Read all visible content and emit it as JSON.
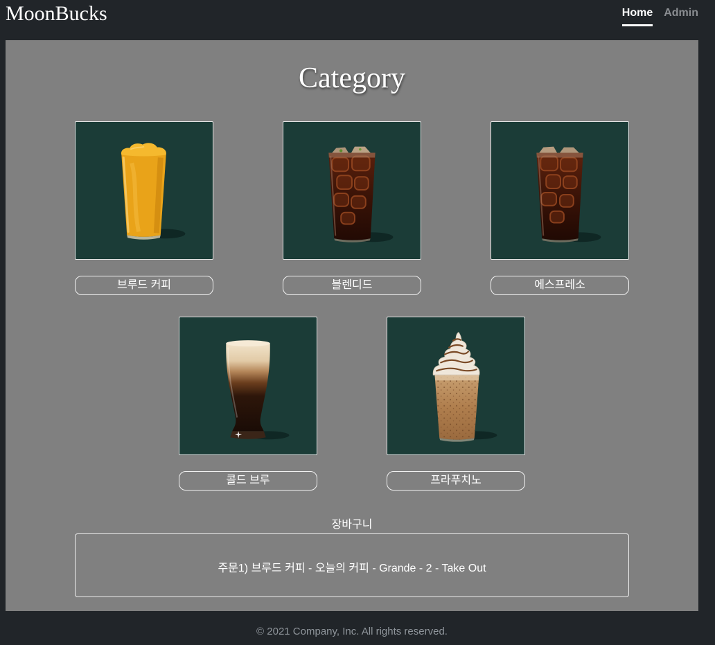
{
  "theme": {
    "page_bg": "#212529",
    "panel_bg": "#808080",
    "thumb_bg": "#1b3c37",
    "text": "#ffffff",
    "muted": "#8f959b"
  },
  "nav": {
    "brand": "MoonBucks",
    "links": [
      {
        "label": "Home",
        "active": true
      },
      {
        "label": "Admin",
        "active": false
      }
    ]
  },
  "page": {
    "title": "Category"
  },
  "categories": [
    {
      "label": "브루드 커피",
      "icon": "smoothie-drink-icon"
    },
    {
      "label": "블렌디드",
      "icon": "iced-coffee-icon"
    },
    {
      "label": "에스프레소",
      "icon": "iced-coffee-icon"
    },
    {
      "label": "콜드 브루",
      "icon": "cold-brew-icon"
    },
    {
      "label": "프라푸치노",
      "icon": "frappuccino-icon"
    }
  ],
  "cart": {
    "label": "장바구니",
    "orders": [
      "주문1) 브루드 커피 - 오늘의 커피 - Grande - 2 - Take Out"
    ]
  },
  "footer": {
    "text": "© 2021 Company, Inc. All rights reserved."
  }
}
